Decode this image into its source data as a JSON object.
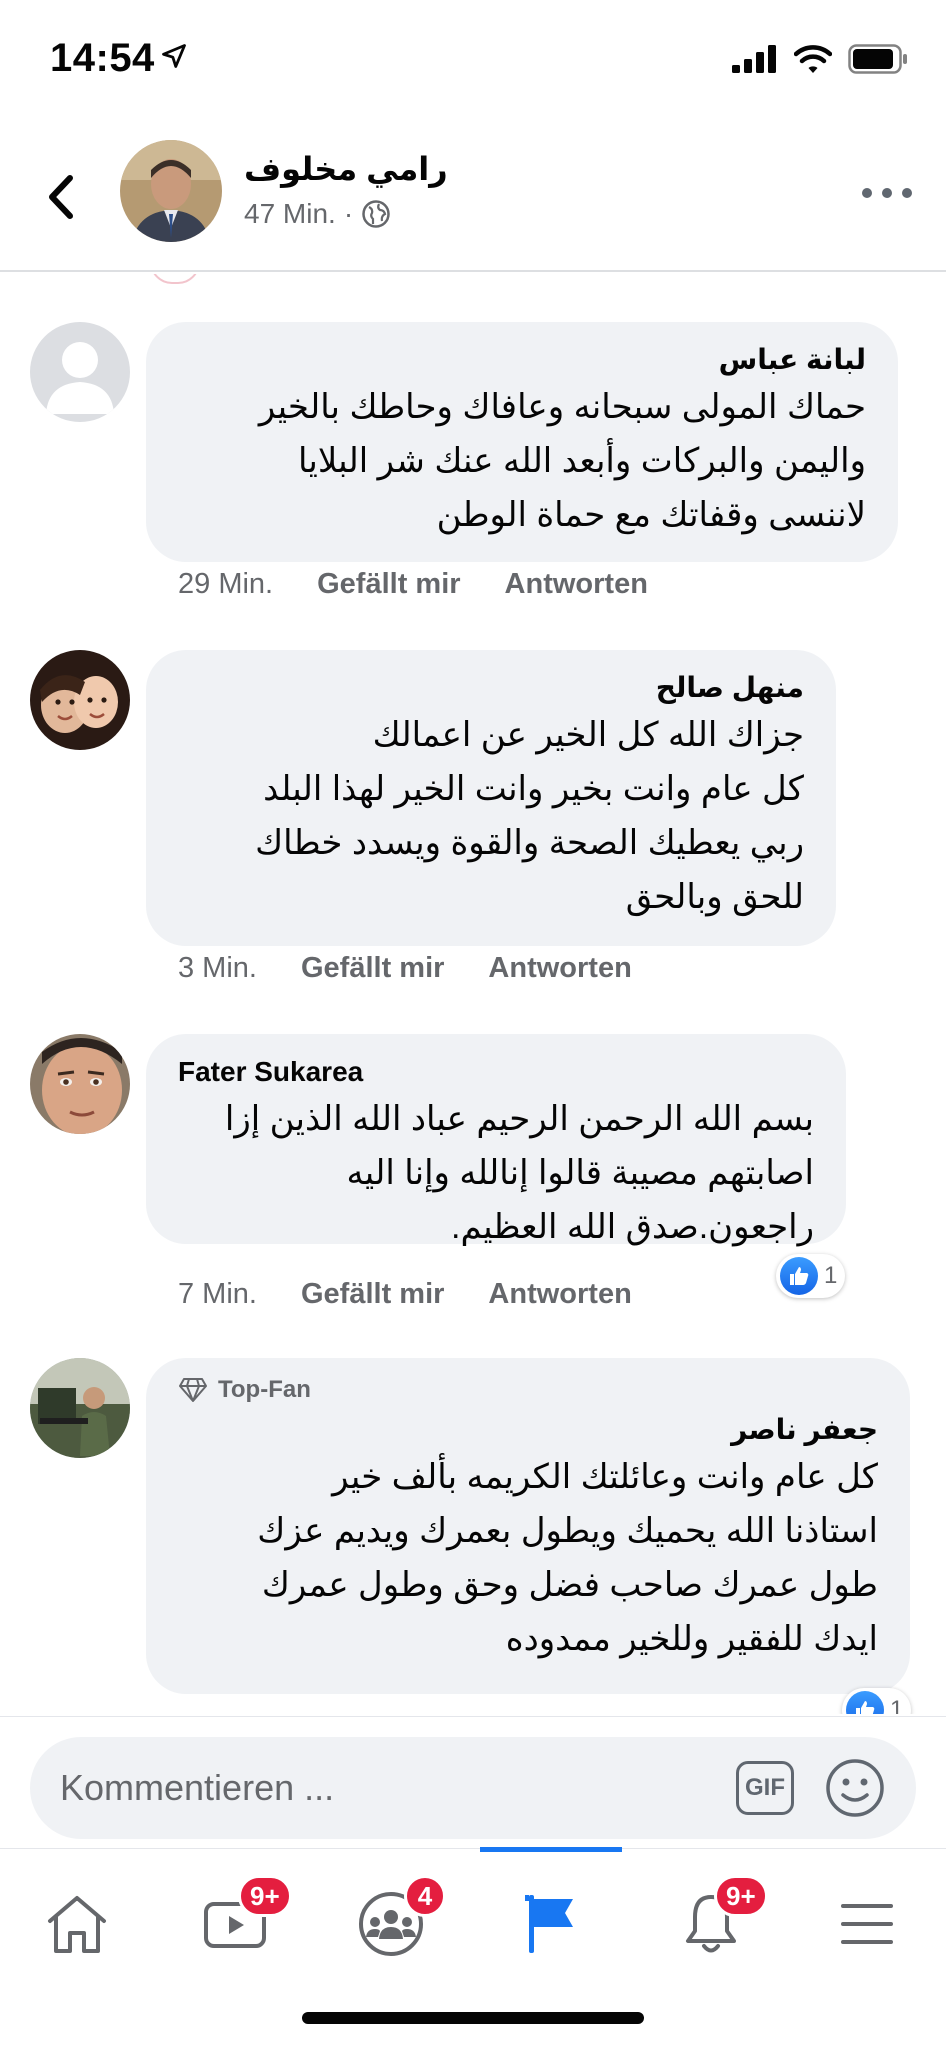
{
  "status_bar": {
    "time": "14:54"
  },
  "header": {
    "page_name": "رامي مخلوف",
    "post_age": "47 Min.",
    "separator": "·"
  },
  "comments": [
    {
      "author": "لبانة عباس",
      "text": "حماك المولى سبحانه وعافاك وحاطك بالخير\nواليمن والبركات وأبعد الله عنك شر البلايا\nلاننسى وقفاتك مع حماة الوطن",
      "time": "29 Min.",
      "like_label": "Gefällt mir",
      "reply_label": "Antworten"
    },
    {
      "author": "منهل صالح",
      "text": "جزاك الله كل الخير عن اعمالك\nكل عام وانت بخير وانت الخير لهذا البلد\nربي يعطيك الصحة والقوة ويسدد خطاك\nللحق وبالحق",
      "time": "3 Min.",
      "like_label": "Gefällt mir",
      "reply_label": "Antworten"
    },
    {
      "author": "Fater Sukarea",
      "text": "بسم الله الرحمن الرحيم عباد الله الذين إزا\nاصابتهم مصيبة قالوا إنالله وإنا اليه\nراجعون.صدق الله العظيم.",
      "time": "7 Min.",
      "like_label": "Gefällt mir",
      "reply_label": "Antworten",
      "reaction_count": "1"
    },
    {
      "badge": "Top-Fan",
      "author": "جعفر ناصر",
      "text": "كل عام وانت وعائلتك الكريمه بألف خير\nاستاذنا الله يحميك ويطول بعمرك ويديم عزك\nطول عمرك صاحب فضل وحق وطول عمرك\nايدك للفقير وللخير ممدوده",
      "reaction_count": "1"
    }
  ],
  "composer": {
    "placeholder": "Kommentieren ...",
    "gif_label": "GIF"
  },
  "bottom_nav": {
    "watch_badge": "9+",
    "groups_badge": "4",
    "notifications_badge": "9+"
  },
  "colors": {
    "accent": "#1877f2",
    "badge": "#e41e3f",
    "bubble": "#f0f2f5",
    "secondary_text": "#65676b"
  }
}
